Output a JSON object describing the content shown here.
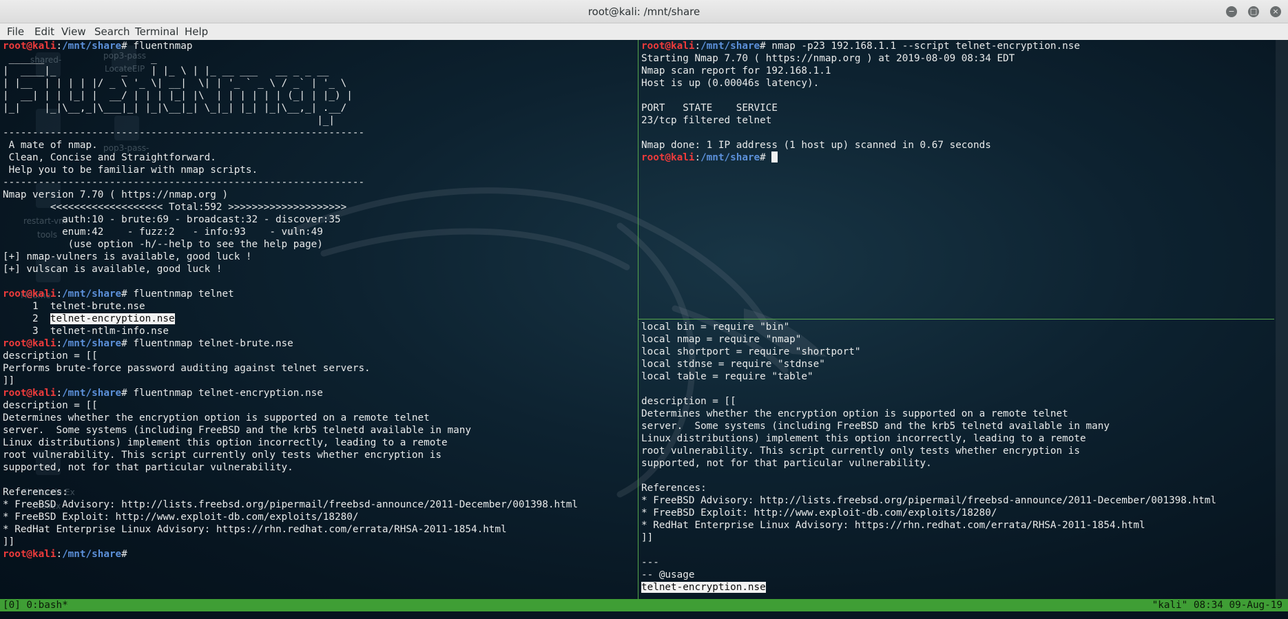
{
  "window": {
    "title": "root@kali: /mnt/share",
    "controls": {
      "minimize": "−",
      "maximize": "□",
      "close": "×"
    }
  },
  "menu": [
    "File",
    "Edit",
    "View",
    "Search",
    "Terminal",
    "Help"
  ],
  "prompt": {
    "user": "root@kali",
    "sep": ":",
    "path": "/mnt/share",
    "hash": "#"
  },
  "desktop_icons": [
    {
      "label": "shared-"
    },
    {
      "label": "pop3-pass"
    },
    {
      "label": "LocateEIP"
    },
    {
      "label": "pop3-pass-"
    },
    {
      "label": "restart-vm"
    },
    {
      "label": "tools"
    },
    {
      "label": "Findme"
    },
    {
      "label": "Shellcode Ex"
    },
    {
      "label": "shellex"
    }
  ],
  "left_pane": {
    "lines": [
      {
        "prompt": true,
        "cmd": " fluentnmap"
      },
      {
        "text": " ______                  _                                         "
      },
      {
        "text": "|  ____|_           _    | |_ \\ | |_ __ ___   __ _ _ __          "
      },
      {
        "text": "| |__  | | | | |/ _ \\ '_ \\| __|  \\| | '_ ` _ \\ / _` | '_ \\     "
      },
      {
        "text": "|  __| | | |_| |  __/ | | | |_| |\\  | | | | | | (_| | |_) |      "
      },
      {
        "text": "|_|    |_|\\__,_|\\___|_| |_|\\__|_| \\_|_| |_| |_|\\__,_| .__/     "
      },
      {
        "text": "                                                     |_|           "
      },
      {
        "text": "-------------------------------------------------------------"
      },
      {
        "text": " A mate of nmap."
      },
      {
        "text": " Clean, Concise and Straightforward."
      },
      {
        "text": " Help you to be familiar with nmap scripts."
      },
      {
        "text": "-------------------------------------------------------------"
      },
      {
        "text": "Nmap version 7.70 ( https://nmap.org )"
      },
      {
        "text": "        <<<<<<<<<<<<<<<<<<< Total:592 >>>>>>>>>>>>>>>>>>>>"
      },
      {
        "text": "          auth:10 - brute:69 - broadcast:32 - discover:35"
      },
      {
        "text": "          enum:42    - fuzz:2   - info:93    - vuln:49"
      },
      {
        "text": "           (use option -h/--help to see the help page)"
      },
      {
        "text": "[+] nmap-vulners is available, good luck !"
      },
      {
        "text": "[+] vulscan is available, good luck !"
      },
      {
        "text": ""
      },
      {
        "prompt": true,
        "cmd": " fluentnmap telnet"
      },
      {
        "text": "     1  telnet-brute.nse"
      },
      {
        "pre": "     2  ",
        "hl": "telnet-encryption.nse"
      },
      {
        "text": "     3  telnet-ntlm-info.nse"
      },
      {
        "prompt": true,
        "cmd": " fluentnmap telnet-brute.nse"
      },
      {
        "text": "description = [["
      },
      {
        "text": "Performs brute-force password auditing against telnet servers."
      },
      {
        "text": "]]"
      },
      {
        "prompt": true,
        "cmd": " fluentnmap telnet-encryption.nse"
      },
      {
        "text": "description = [["
      },
      {
        "text": "Determines whether the encryption option is supported on a remote telnet"
      },
      {
        "text": "server.  Some systems (including FreeBSD and the krb5 telnetd available in many"
      },
      {
        "text": "Linux distributions) implement this option incorrectly, leading to a remote"
      },
      {
        "text": "root vulnerability. This script currently only tests whether encryption is"
      },
      {
        "text": "supported, not for that particular vulnerability."
      },
      {
        "text": ""
      },
      {
        "text": "References:"
      },
      {
        "text": "* FreeBSD Advisory: http://lists.freebsd.org/pipermail/freebsd-announce/2011-December/001398.html"
      },
      {
        "text": "* FreeBSD Exploit: http://www.exploit-db.com/exploits/18280/"
      },
      {
        "text": "* RedHat Enterprise Linux Advisory: https://rhn.redhat.com/errata/RHSA-2011-1854.html"
      },
      {
        "text": "]]"
      },
      {
        "prompt": true,
        "cmd": ""
      }
    ]
  },
  "right_top_pane": {
    "lines": [
      {
        "prompt": true,
        "cmd": " nmap -p23 192.168.1.1 --script telnet-encryption.nse"
      },
      {
        "text": "Starting Nmap 7.70 ( https://nmap.org ) at 2019-08-09 08:34 EDT"
      },
      {
        "text": "Nmap scan report for 192.168.1.1"
      },
      {
        "text": "Host is up (0.00046s latency)."
      },
      {
        "text": ""
      },
      {
        "text": "PORT   STATE    SERVICE"
      },
      {
        "text": "23/tcp filtered telnet"
      },
      {
        "text": ""
      },
      {
        "text": "Nmap done: 1 IP address (1 host up) scanned in 0.67 seconds"
      },
      {
        "prompt": true,
        "cmd": " ",
        "cursor": true
      }
    ]
  },
  "right_bottom_pane": {
    "lines": [
      {
        "text": "local bin = require \"bin\""
      },
      {
        "text": "local nmap = require \"nmap\""
      },
      {
        "text": "local shortport = require \"shortport\""
      },
      {
        "text": "local stdnse = require \"stdnse\""
      },
      {
        "text": "local table = require \"table\""
      },
      {
        "text": ""
      },
      {
        "text": "description = [["
      },
      {
        "text": "Determines whether the encryption option is supported on a remote telnet"
      },
      {
        "text": "server.  Some systems (including FreeBSD and the krb5 telnetd available in many"
      },
      {
        "text": "Linux distributions) implement this option incorrectly, leading to a remote"
      },
      {
        "text": "root vulnerability. This script currently only tests whether encryption is"
      },
      {
        "text": "supported, not for that particular vulnerability."
      },
      {
        "text": ""
      },
      {
        "text": "References:"
      },
      {
        "text": "* FreeBSD Advisory: http://lists.freebsd.org/pipermail/freebsd-announce/2011-December/001398.html"
      },
      {
        "text": "* FreeBSD Exploit: http://www.exploit-db.com/exploits/18280/"
      },
      {
        "text": "* RedHat Enterprise Linux Advisory: https://rhn.redhat.com/errata/RHSA-2011-1854.html"
      },
      {
        "text": "]]"
      },
      {
        "text": ""
      },
      {
        "text": "---"
      },
      {
        "text": "-- @usage"
      },
      {
        "pre": "",
        "hl": "telnet-encryption.nse"
      }
    ]
  },
  "status_bar": {
    "left": "[0] 0:bash*",
    "right": "\"kali\" 08:34 09-Aug-19"
  }
}
